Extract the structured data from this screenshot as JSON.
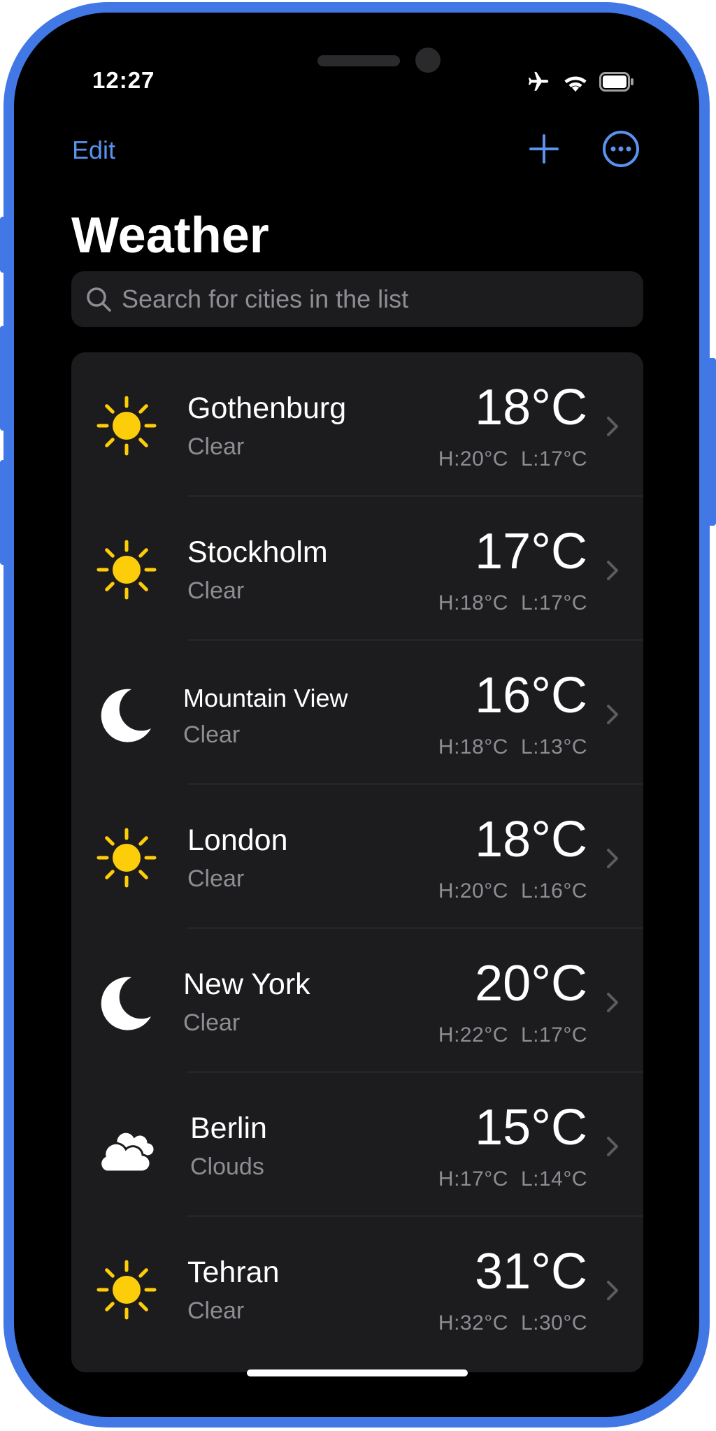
{
  "status_bar": {
    "time": "12:27",
    "icons": [
      "airplane-icon",
      "wifi-icon",
      "battery-icon"
    ]
  },
  "nav": {
    "edit_label": "Edit",
    "add_icon": "plus-icon",
    "more_icon": "ellipsis-circle-icon"
  },
  "page_title": "Weather",
  "search": {
    "placeholder": "Search for cities in the list"
  },
  "colors": {
    "accent": "#5a92ee",
    "frame": "#4277e6",
    "background": "#000000",
    "card": "#1c1c1e",
    "secondary_text": "#8d8d93",
    "sun": "#fecd0a"
  },
  "cities": [
    {
      "name": "Gothenburg",
      "condition": "Clear",
      "temp": "18°C",
      "high": "H:20°C",
      "low": "L:17°C",
      "icon": "sun-icon"
    },
    {
      "name": "Stockholm",
      "condition": "Clear",
      "temp": "17°C",
      "high": "H:18°C",
      "low": "L:17°C",
      "icon": "sun-icon"
    },
    {
      "name": "Mountain View",
      "condition": "Clear",
      "temp": "16°C",
      "high": "H:18°C",
      "low": "L:13°C",
      "icon": "moon-icon"
    },
    {
      "name": "London",
      "condition": "Clear",
      "temp": "18°C",
      "high": "H:20°C",
      "low": "L:16°C",
      "icon": "sun-icon"
    },
    {
      "name": "New York",
      "condition": "Clear",
      "temp": "20°C",
      "high": "H:22°C",
      "low": "L:17°C",
      "icon": "moon-icon"
    },
    {
      "name": "Berlin",
      "condition": "Clouds",
      "temp": "15°C",
      "high": "H:17°C",
      "low": "L:14°C",
      "icon": "clouds-icon"
    },
    {
      "name": "Tehran",
      "condition": "Clear",
      "temp": "31°C",
      "high": "H:32°C",
      "low": "L:30°C",
      "icon": "sun-icon"
    }
  ]
}
